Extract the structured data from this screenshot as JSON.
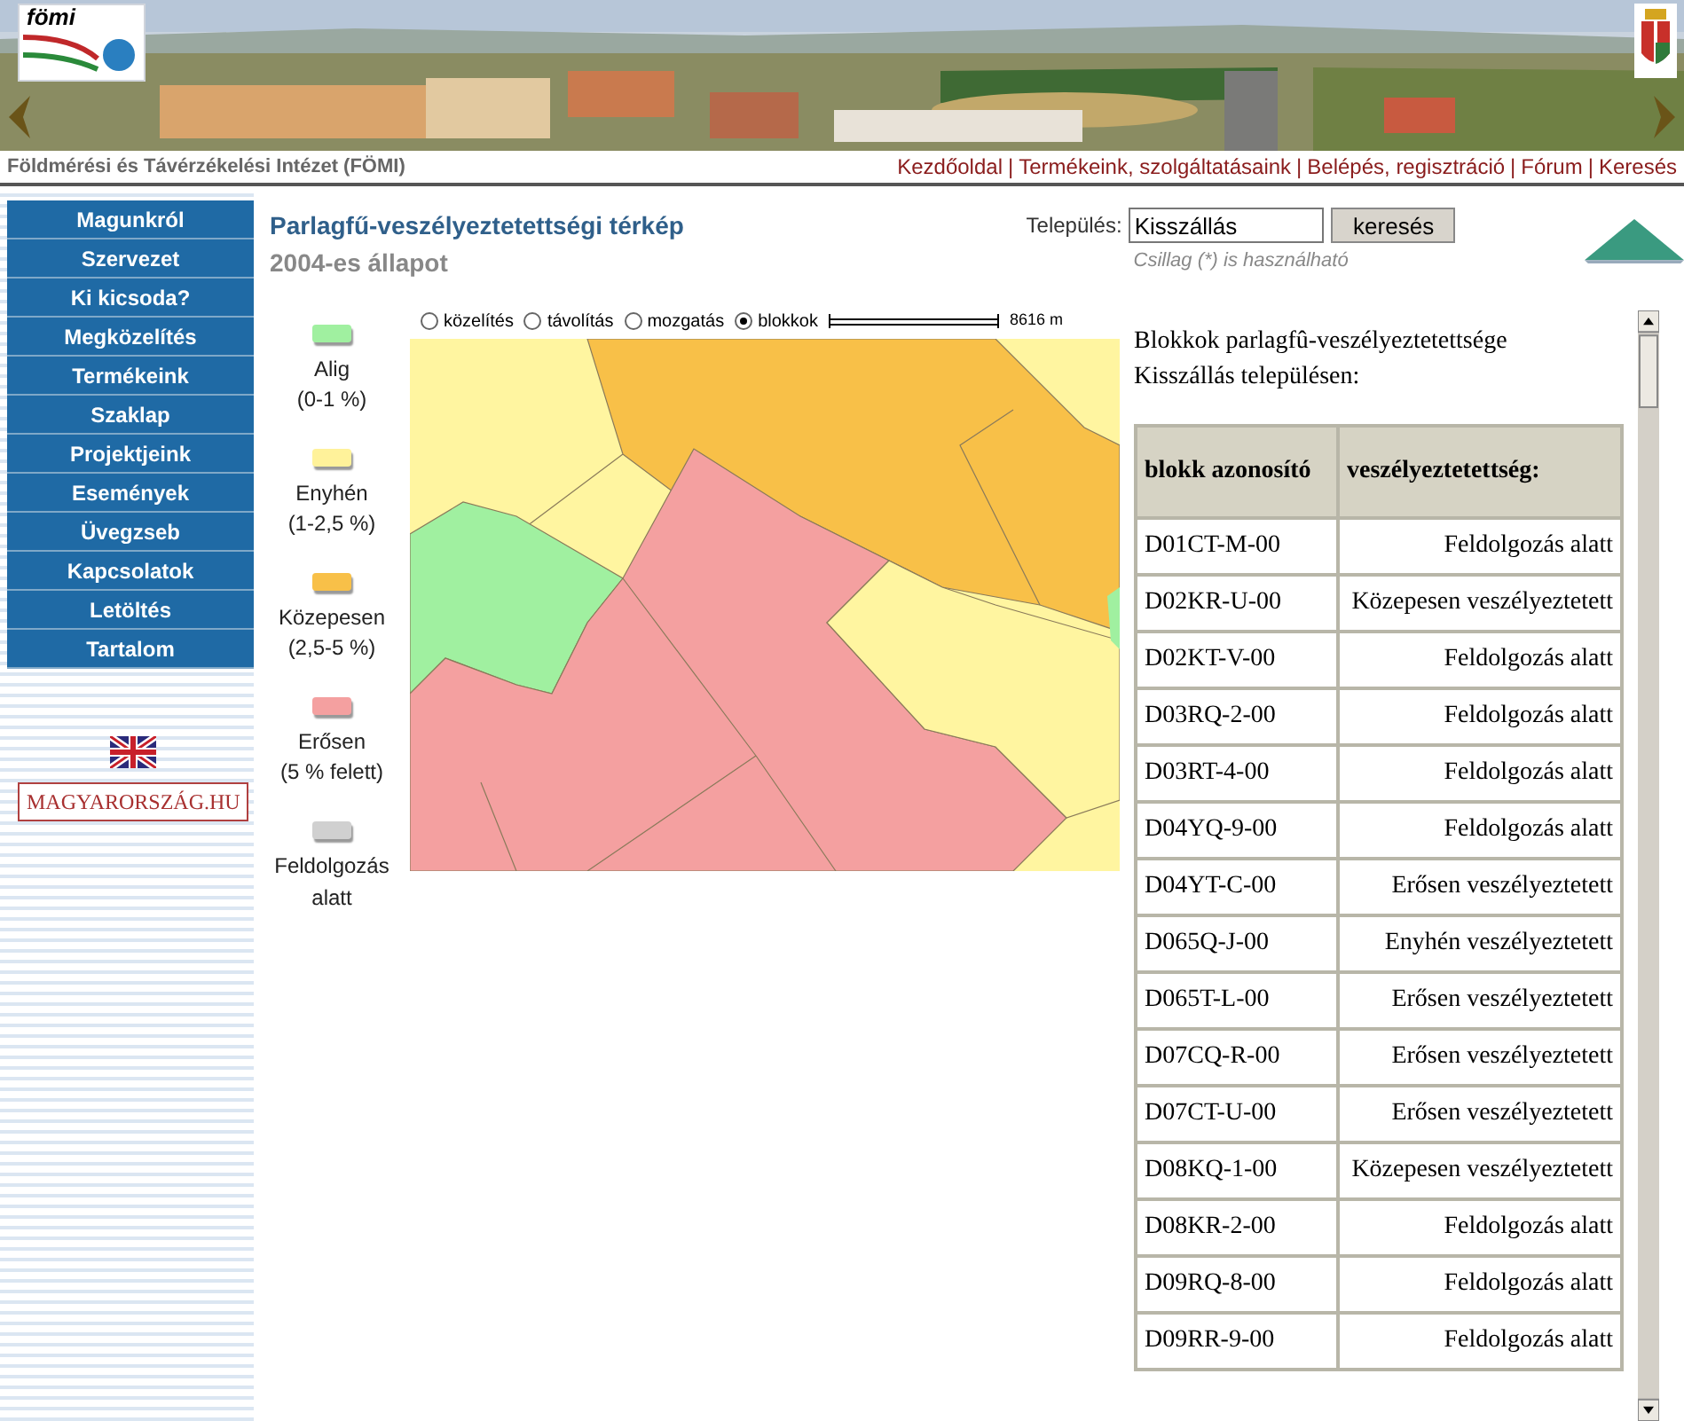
{
  "banner": {
    "logo_text": "fömi"
  },
  "header": {
    "title": "Földmérési és Távérzékelési Intézet (FÖMI)",
    "links": [
      {
        "label": "Kezdőoldal"
      },
      {
        "label": "Termékeink, szolgáltatásaink"
      },
      {
        "label": "Belépés, regisztráció"
      },
      {
        "label": "Fórum"
      },
      {
        "label": "Keresés"
      }
    ],
    "separators": [
      "|",
      "|",
      "|",
      "|"
    ]
  },
  "sidebar": {
    "items": [
      {
        "label": "Magunkról"
      },
      {
        "label": "Szervezet"
      },
      {
        "label": "Ki kicsoda?"
      },
      {
        "label": "Megközelítés"
      },
      {
        "label": "Termékeink"
      },
      {
        "label": "Szaklap"
      },
      {
        "label": "Projektjeink"
      },
      {
        "label": "Események"
      },
      {
        "label": "Üvegzseb"
      },
      {
        "label": "Kapcsolatok"
      },
      {
        "label": "Letöltés"
      },
      {
        "label": "Tartalom"
      }
    ],
    "portal_logo": "MAGYARORSZÁG.HU"
  },
  "page": {
    "title": "Parlagfű-veszélyeztetettségi térkép",
    "subtitle": "2004-es állapot"
  },
  "search": {
    "label": "Település:",
    "value": "Kisszállás",
    "button": "keresés",
    "hint": "Csillag (*) is használható"
  },
  "legend": [
    {
      "label": "Alig",
      "range": "(0-1 %)",
      "color": "#a0f0a0"
    },
    {
      "label": "Enyhén",
      "range": "(1-2,5 %)",
      "color": "#fff29a"
    },
    {
      "label": "Közepesen",
      "range": "(2,5-5 %)",
      "color": "#f8c048"
    },
    {
      "label": "Erősen",
      "range": "(5 % felett)",
      "color": "#f4a0a0"
    },
    {
      "label": "Feldolgozás alatt",
      "color": "#d0d0d0"
    }
  ],
  "map_tools": [
    {
      "label": "közelítés",
      "selected": false
    },
    {
      "label": "távolítás",
      "selected": false
    },
    {
      "label": "mozgatás",
      "selected": false
    },
    {
      "label": "blokkok",
      "selected": true
    }
  ],
  "scale": "8616 m",
  "results": {
    "intro": "Blokkok parlagfû-veszélyeztetettsége Kisszállás településen:",
    "columns": [
      "blokk azonosító",
      "veszélyeztetettség:"
    ],
    "rows": [
      [
        "D01CT-M-00",
        "Feldolgozás alatt"
      ],
      [
        "D02KR-U-00",
        "Közepesen veszélyeztetett"
      ],
      [
        "D02KT-V-00",
        "Feldolgozás alatt"
      ],
      [
        "D03RQ-2-00",
        "Feldolgozás alatt"
      ],
      [
        "D03RT-4-00",
        "Feldolgozás alatt"
      ],
      [
        "D04YQ-9-00",
        "Feldolgozás alatt"
      ],
      [
        "D04YT-C-00",
        "Erősen veszélyeztetett"
      ],
      [
        "D065Q-J-00",
        "Enyhén veszélyeztetett"
      ],
      [
        "D065T-L-00",
        "Erősen veszélyeztetett"
      ],
      [
        "D07CQ-R-00",
        "Erősen veszélyeztetett"
      ],
      [
        "D07CT-U-00",
        "Erősen veszélyeztetett"
      ],
      [
        "D08KQ-1-00",
        "Közepesen veszélyeztetett"
      ],
      [
        "D08KR-2-00",
        "Feldolgozás alatt"
      ],
      [
        "D09RQ-8-00",
        "Feldolgozás alatt"
      ],
      [
        "D09RR-9-00",
        "Feldolgozás alatt"
      ]
    ]
  }
}
